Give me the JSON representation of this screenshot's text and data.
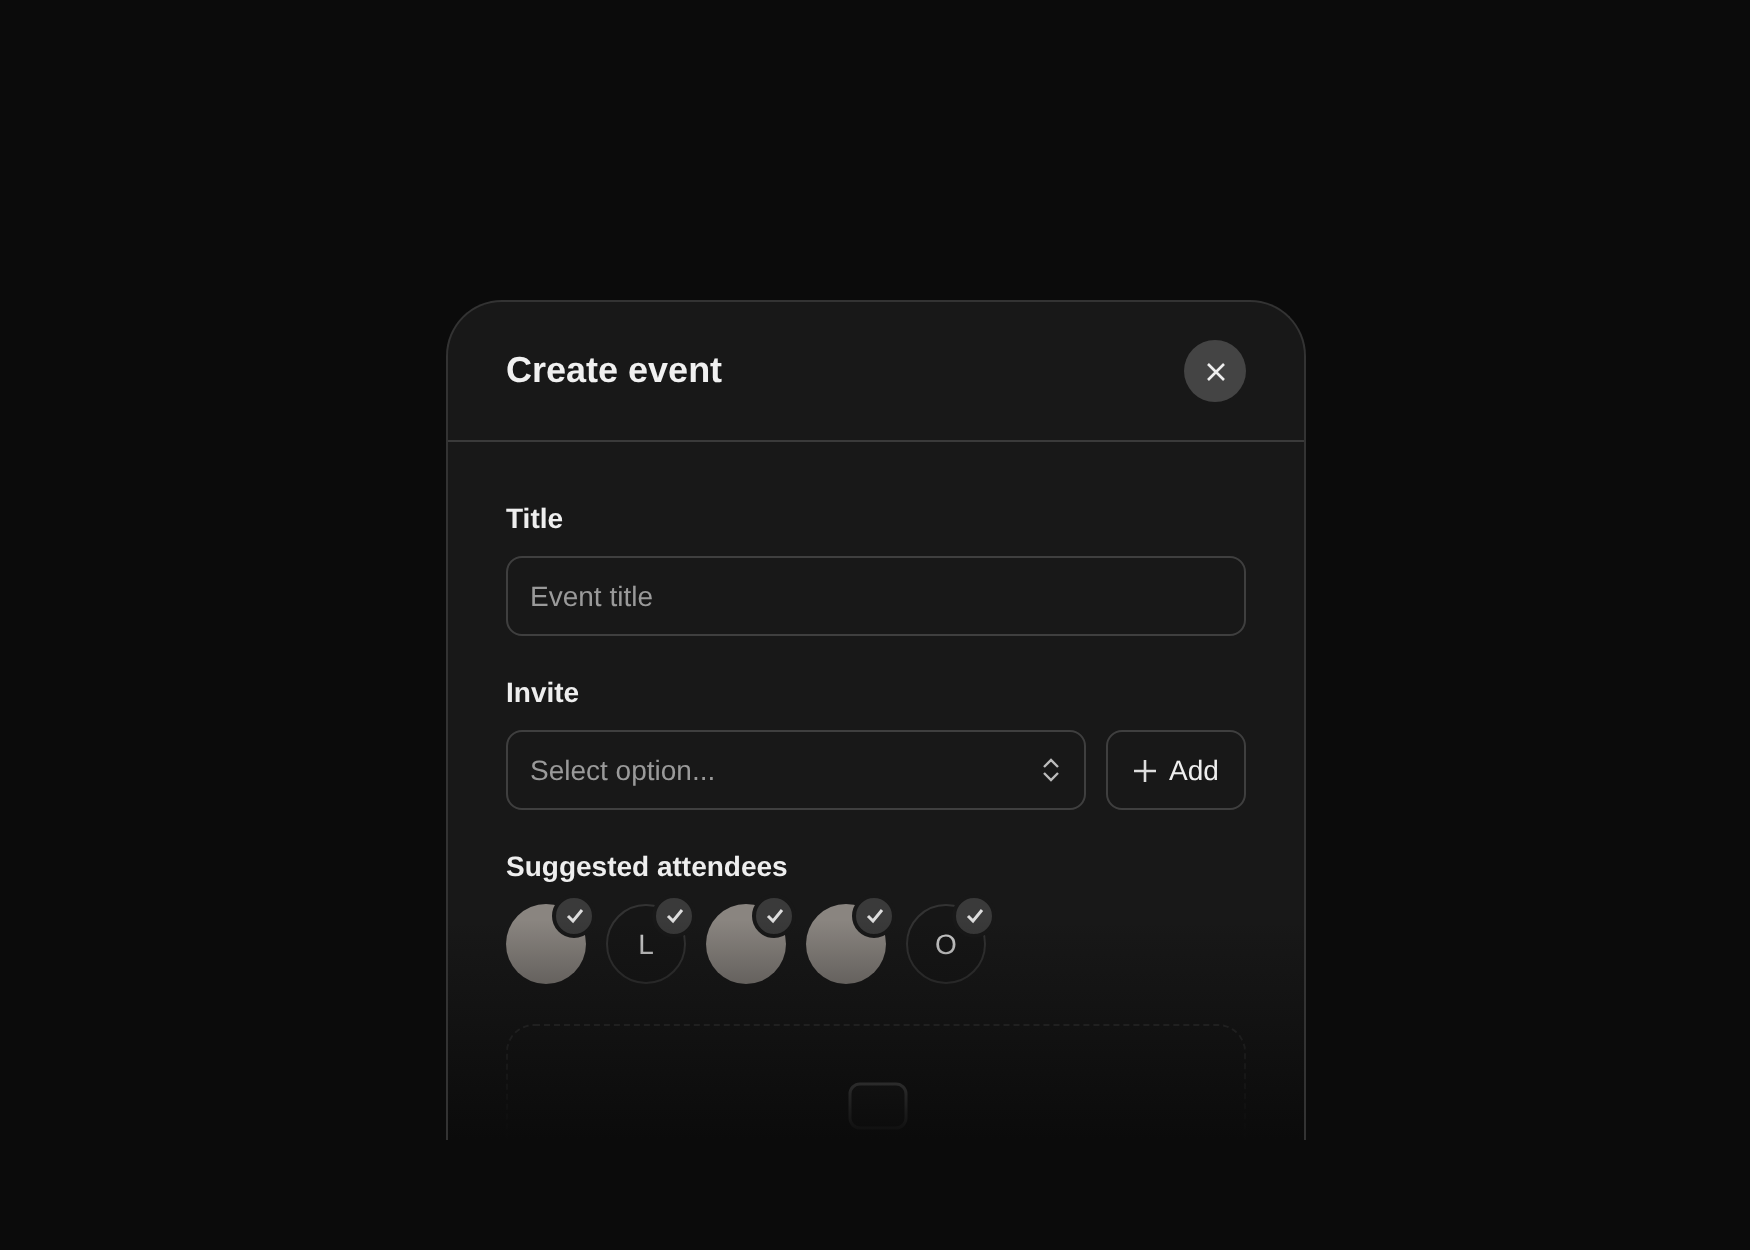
{
  "dialog": {
    "title": "Create event"
  },
  "title_field": {
    "label": "Title",
    "placeholder": "Event title"
  },
  "invite": {
    "label": "Invite",
    "placeholder": "Select option...",
    "add_button": "Add"
  },
  "suggested": {
    "label": "Suggested attendees",
    "attendees": [
      {
        "kind": "photo",
        "checked": true
      },
      {
        "kind": "initial",
        "initial": "L",
        "checked": true
      },
      {
        "kind": "photo",
        "checked": true
      },
      {
        "kind": "photo",
        "checked": true
      },
      {
        "kind": "initial",
        "initial": "O",
        "checked": true
      }
    ]
  }
}
